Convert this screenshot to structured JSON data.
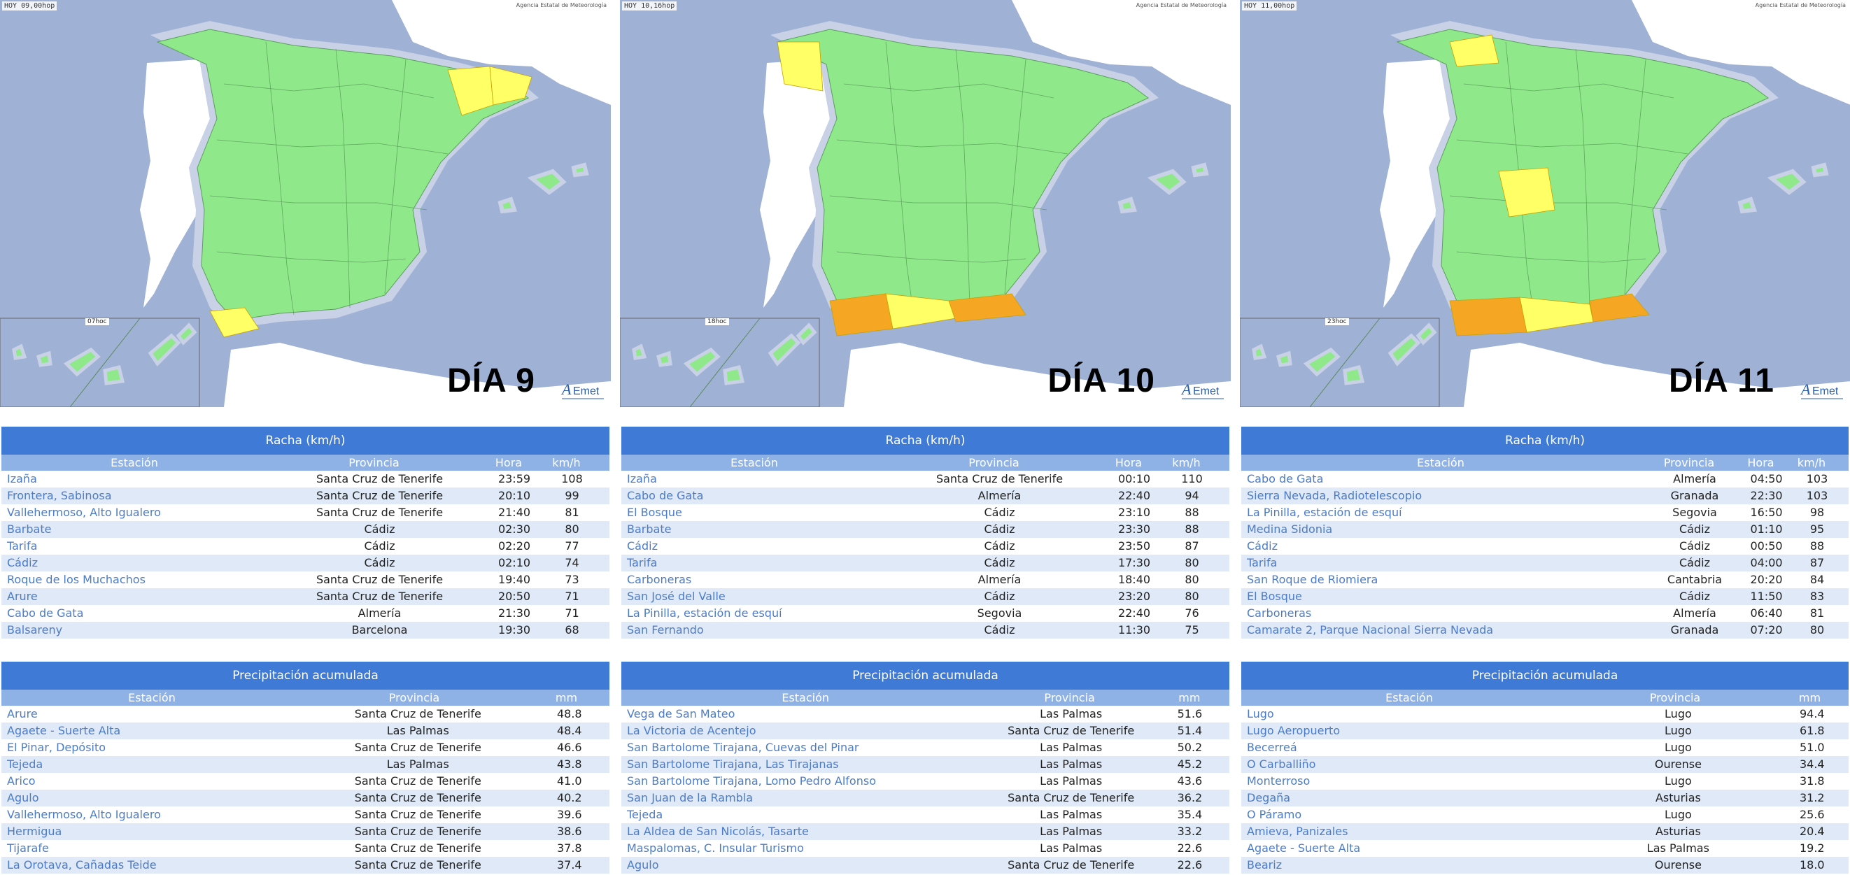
{
  "colors": {
    "header": "#3f7ad6",
    "subheader": "#8fb2e6",
    "link": "#4c7cc8",
    "green": "#8fe88a",
    "yellow": "#ffff66",
    "orange": "#f5a623",
    "sea": "#9fb2d6"
  },
  "panels": [
    {
      "map": {
        "stamp": "HOY 09,00hop",
        "agency": "Agencia Estatal de Meteorología",
        "day": "DÍA 9",
        "inset_time": "07hoc"
      },
      "gust": {
        "title": "Racha (km/h)",
        "headers": {
          "station": "Estación",
          "province": "Provincia",
          "hour": "Hora",
          "value": "km/h"
        },
        "rows": [
          {
            "station": "Izaña",
            "province": "Santa Cruz de Tenerife",
            "hour": "23:59",
            "value": "108"
          },
          {
            "station": "Frontera, Sabinosa",
            "province": "Santa Cruz de Tenerife",
            "hour": "20:10",
            "value": "99"
          },
          {
            "station": "Vallehermoso, Alto Igualero",
            "province": "Santa Cruz de Tenerife",
            "hour": "21:40",
            "value": "81"
          },
          {
            "station": "Barbate",
            "province": "Cádiz",
            "hour": "02:30",
            "value": "80"
          },
          {
            "station": "Tarifa",
            "province": "Cádiz",
            "hour": "02:20",
            "value": "77"
          },
          {
            "station": "Cádiz",
            "province": "Cádiz",
            "hour": "02:10",
            "value": "74"
          },
          {
            "station": "Roque de los Muchachos",
            "province": "Santa Cruz de Tenerife",
            "hour": "19:40",
            "value": "73"
          },
          {
            "station": "Arure",
            "province": "Santa Cruz de Tenerife",
            "hour": "20:50",
            "value": "71"
          },
          {
            "station": "Cabo de Gata",
            "province": "Almería",
            "hour": "21:30",
            "value": "71"
          },
          {
            "station": "Balsareny",
            "province": "Barcelona",
            "hour": "19:30",
            "value": "68"
          }
        ]
      },
      "rain": {
        "title": "Precipitación acumulada",
        "headers": {
          "station": "Estación",
          "province": "Provincia",
          "value": "mm"
        },
        "rows": [
          {
            "station": "Arure",
            "province": "Santa Cruz de Tenerife",
            "value": "48.8"
          },
          {
            "station": "Agaete - Suerte Alta",
            "province": "Las Palmas",
            "value": "48.4"
          },
          {
            "station": "El Pinar, Depósito",
            "province": "Santa Cruz de Tenerife",
            "value": "46.6"
          },
          {
            "station": "Tejeda",
            "province": "Las Palmas",
            "value": "43.8"
          },
          {
            "station": "Arico",
            "province": "Santa Cruz de Tenerife",
            "value": "41.0"
          },
          {
            "station": "Agulo",
            "province": "Santa Cruz de Tenerife",
            "value": "40.2"
          },
          {
            "station": "Vallehermoso, Alto Igualero",
            "province": "Santa Cruz de Tenerife",
            "value": "39.6"
          },
          {
            "station": "Hermigua",
            "province": "Santa Cruz de Tenerife",
            "value": "38.6"
          },
          {
            "station": "Tijarafe",
            "province": "Santa Cruz de Tenerife",
            "value": "37.8"
          },
          {
            "station": "La Orotava, Cañadas Teide",
            "province": "Santa Cruz de Tenerife",
            "value": "37.4"
          }
        ]
      }
    },
    {
      "map": {
        "stamp": "HOY 10,16hop",
        "agency": "Agencia Estatal de Meteorología",
        "day": "DÍA 10",
        "inset_time": "18hoc"
      },
      "gust": {
        "title": "Racha (km/h)",
        "headers": {
          "station": "Estación",
          "province": "Provincia",
          "hour": "Hora",
          "value": "km/h"
        },
        "rows": [
          {
            "station": "Izaña",
            "province": "Santa Cruz de Tenerife",
            "hour": "00:10",
            "value": "110"
          },
          {
            "station": "Cabo de Gata",
            "province": "Almería",
            "hour": "22:40",
            "value": "94"
          },
          {
            "station": "El Bosque",
            "province": "Cádiz",
            "hour": "23:10",
            "value": "88"
          },
          {
            "station": "Barbate",
            "province": "Cádiz",
            "hour": "23:30",
            "value": "88"
          },
          {
            "station": "Cádiz",
            "province": "Cádiz",
            "hour": "23:50",
            "value": "87"
          },
          {
            "station": "Tarifa",
            "province": "Cádiz",
            "hour": "17:30",
            "value": "80"
          },
          {
            "station": "Carboneras",
            "province": "Almería",
            "hour": "18:40",
            "value": "80"
          },
          {
            "station": "San José del Valle",
            "province": "Cádiz",
            "hour": "23:20",
            "value": "80"
          },
          {
            "station": "La Pinilla, estación de esquí",
            "province": "Segovia",
            "hour": "22:40",
            "value": "76"
          },
          {
            "station": "San Fernando",
            "province": "Cádiz",
            "hour": "11:30",
            "value": "75"
          }
        ]
      },
      "rain": {
        "title": "Precipitación acumulada",
        "headers": {
          "station": "Estación",
          "province": "Provincia",
          "value": "mm"
        },
        "rows": [
          {
            "station": "Vega de San Mateo",
            "province": "Las Palmas",
            "value": "51.6"
          },
          {
            "station": "La Victoria de Acentejo",
            "province": "Santa Cruz de Tenerife",
            "value": "51.4"
          },
          {
            "station": "San Bartolome Tirajana, Cuevas del Pinar",
            "province": "Las Palmas",
            "value": "50.2"
          },
          {
            "station": "San Bartolome Tirajana, Las Tirajanas",
            "province": "Las Palmas",
            "value": "45.2"
          },
          {
            "station": "San Bartolome Tirajana, Lomo Pedro Alfonso",
            "province": "Las Palmas",
            "value": "43.6"
          },
          {
            "station": "San Juan de la Rambla",
            "province": "Santa Cruz de Tenerife",
            "value": "36.2"
          },
          {
            "station": "Tejeda",
            "province": "Las Palmas",
            "value": "35.4"
          },
          {
            "station": "La Aldea de San Nicolás, Tasarte",
            "province": "Las Palmas",
            "value": "33.2"
          },
          {
            "station": "Maspalomas, C. Insular Turismo",
            "province": "Las Palmas",
            "value": "22.6"
          },
          {
            "station": "Agulo",
            "province": "Santa Cruz de Tenerife",
            "value": "22.6"
          }
        ]
      }
    },
    {
      "map": {
        "stamp": "HOY 11,00hop",
        "agency": "Agencia Estatal de Meteorología",
        "day": "DÍA 11",
        "inset_time": "23hoc"
      },
      "gust": {
        "title": "Racha (km/h)",
        "headers": {
          "station": "Estación",
          "province": "Provincia",
          "hour": "Hora",
          "value": "km/h"
        },
        "rows": [
          {
            "station": "Cabo de Gata",
            "province": "Almería",
            "hour": "04:50",
            "value": "103"
          },
          {
            "station": "Sierra Nevada, Radiotelescopio",
            "province": "Granada",
            "hour": "22:30",
            "value": "103"
          },
          {
            "station": "La Pinilla, estación de esquí",
            "province": "Segovia",
            "hour": "16:50",
            "value": "98"
          },
          {
            "station": "Medina Sidonia",
            "province": "Cádiz",
            "hour": "01:10",
            "value": "95"
          },
          {
            "station": "Cádiz",
            "province": "Cádiz",
            "hour": "00:50",
            "value": "88"
          },
          {
            "station": "Tarifa",
            "province": "Cádiz",
            "hour": "04:00",
            "value": "87"
          },
          {
            "station": "San Roque de Riomiera",
            "province": "Cantabria",
            "hour": "20:20",
            "value": "84"
          },
          {
            "station": "El Bosque",
            "province": "Cádiz",
            "hour": "11:50",
            "value": "83"
          },
          {
            "station": "Carboneras",
            "province": "Almería",
            "hour": "06:40",
            "value": "81"
          },
          {
            "station": "Camarate 2, Parque Nacional Sierra Nevada",
            "province": "Granada",
            "hour": "07:20",
            "value": "80"
          }
        ]
      },
      "rain": {
        "title": "Precipitación acumulada",
        "headers": {
          "station": "Estación",
          "province": "Provincia",
          "value": "mm"
        },
        "rows": [
          {
            "station": "Lugo",
            "province": "Lugo",
            "value": "94.4"
          },
          {
            "station": "Lugo Aeropuerto",
            "province": "Lugo",
            "value": "61.8"
          },
          {
            "station": "Becerreá",
            "province": "Lugo",
            "value": "51.0"
          },
          {
            "station": "O Carballiño",
            "province": "Ourense",
            "value": "34.4"
          },
          {
            "station": "Monterroso",
            "province": "Lugo",
            "value": "31.8"
          },
          {
            "station": "Degaña",
            "province": "Asturias",
            "value": "31.2"
          },
          {
            "station": "O Páramo",
            "province": "Lugo",
            "value": "25.6"
          },
          {
            "station": "Amieva, Panizales",
            "province": "Asturias",
            "value": "20.4"
          },
          {
            "station": "Agaete - Suerte Alta",
            "province": "Las Palmas",
            "value": "19.2"
          },
          {
            "station": "Beariz",
            "province": "Ourense",
            "value": "18.0"
          }
        ]
      }
    }
  ]
}
